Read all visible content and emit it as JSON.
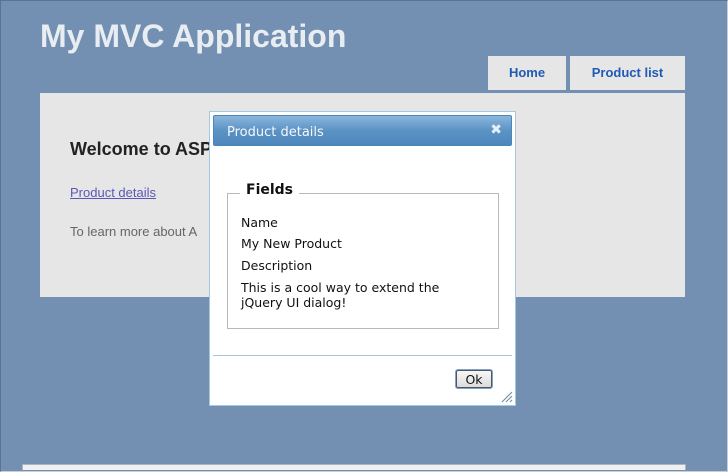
{
  "app": {
    "title": "My MVC Application"
  },
  "menu": {
    "home": "Home",
    "product_list": "Product list"
  },
  "main": {
    "welcome": "Welcome to ASP",
    "details_link": "Product details",
    "learn_more": "To learn more about A"
  },
  "dialog": {
    "title": "Product details",
    "close_icon": "close-icon",
    "legend": "Fields",
    "name_label": "Name",
    "name_value": "My New Product",
    "description_label": "Description",
    "description_value": "This is a cool way to extend the jQuery UI dialog!",
    "ok_label": "Ok"
  },
  "colors": {
    "page_background": "#7390b2",
    "panel_background": "#e6e6e7",
    "menu_text": "#1f5bb5",
    "link": "#5a59b5",
    "dialog_header": "#5b93c5"
  }
}
